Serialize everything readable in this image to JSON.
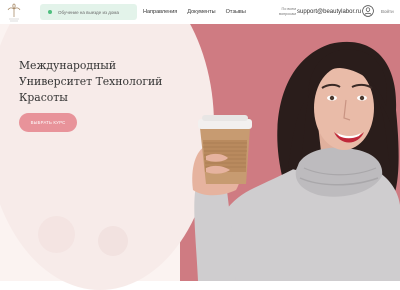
{
  "header": {
    "promo_text": "Обучение на выезде из дома",
    "nav": [
      "Направления",
      "Документы",
      "Отзывы"
    ],
    "questions_label": "По всем вопросам",
    "email": "support@beautylabor.ru",
    "lang": "Войти"
  },
  "hero": {
    "title_line1": "Международный",
    "title_line2": "Университет Технологий",
    "title_line3": "Красоты",
    "cta_label": "ВЫБРАТЬ КУРС"
  },
  "colors": {
    "accent": "#e8939a",
    "photo_background": "#cf7b82",
    "promo_background": "#e3f3ea"
  },
  "icons": {
    "logo": "palm-logo-icon",
    "account": "user-icon",
    "promo": "status-dot-icon"
  }
}
